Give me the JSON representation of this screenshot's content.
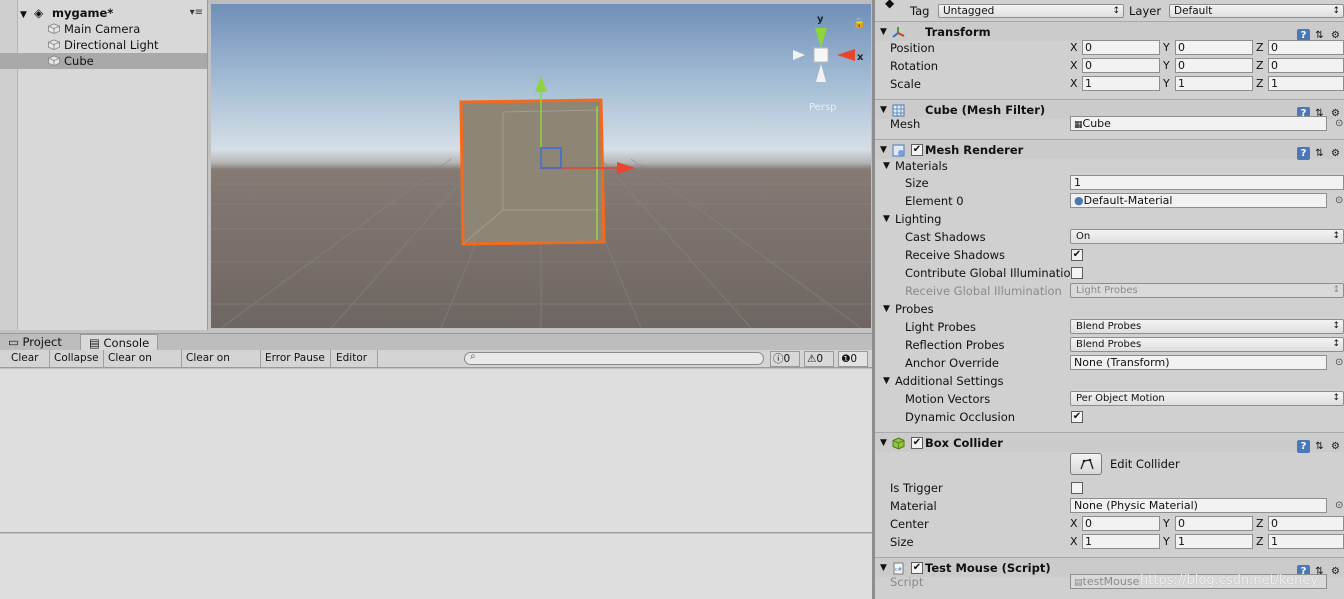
{
  "hierarchy": {
    "root": "mygame*",
    "items": [
      "Main Camera",
      "Directional Light",
      "Cube"
    ],
    "selected": "Cube"
  },
  "scene": {
    "gizmo": {
      "x_label": "x",
      "y_label": "y",
      "persp_label": "Persp"
    }
  },
  "console": {
    "tabs": [
      "Project",
      "Console"
    ],
    "active_tab": "Console",
    "toolbar": [
      "Clear",
      "Collapse",
      "Clear on Play",
      "Clear on Build",
      "Error Pause",
      "Editor"
    ],
    "counts": {
      "info": "0",
      "warning": "0",
      "error": "0"
    }
  },
  "inspector": {
    "tag_label": "Tag",
    "tag_value": "Untagged",
    "layer_label": "Layer",
    "layer_value": "Default",
    "transform": {
      "title": "Transform",
      "rows": [
        {
          "label": "Position",
          "x": "0",
          "y": "0",
          "z": "0"
        },
        {
          "label": "Rotation",
          "x": "0",
          "y": "0",
          "z": "0"
        },
        {
          "label": "Scale",
          "x": "1",
          "y": "1",
          "z": "1"
        }
      ]
    },
    "mesh_filter": {
      "title": "Cube (Mesh Filter)",
      "mesh_label": "Mesh",
      "mesh_value": "Cube"
    },
    "mesh_renderer": {
      "title": "Mesh Renderer",
      "materials_label": "Materials",
      "size_label": "Size",
      "size_value": "1",
      "element0_label": "Element 0",
      "element0_value": "Default-Material",
      "lighting_label": "Lighting",
      "cast_shadows_label": "Cast Shadows",
      "cast_shadows_value": "On",
      "receive_shadows_label": "Receive Shadows",
      "contribute_gi_label": "Contribute Global Illumination",
      "receive_gi_label": "Receive Global Illumination",
      "receive_gi_value": "Light Probes",
      "probes_label": "Probes",
      "light_probes_label": "Light Probes",
      "light_probes_value": "Blend Probes",
      "reflection_probes_label": "Reflection Probes",
      "reflection_probes_value": "Blend Probes",
      "anchor_override_label": "Anchor Override",
      "anchor_override_value": "None (Transform)",
      "additional_label": "Additional Settings",
      "motion_vectors_label": "Motion Vectors",
      "motion_vectors_value": "Per Object Motion",
      "dynamic_occlusion_label": "Dynamic Occlusion"
    },
    "box_collider": {
      "title": "Box Collider",
      "edit_collider_label": "Edit Collider",
      "is_trigger_label": "Is Trigger",
      "material_label": "Material",
      "material_value": "None (Physic Material)",
      "center_label": "Center",
      "center": {
        "x": "0",
        "y": "0",
        "z": "0"
      },
      "size_label": "Size",
      "size": {
        "x": "1",
        "y": "1",
        "z": "1"
      }
    },
    "test_mouse": {
      "title": "Test Mouse (Script)",
      "script_label": "Script",
      "script_value": "testMouse"
    }
  },
  "watermark": "https://blog.csdn.net/keney",
  "colors": {
    "selection_orange": "#f26b1d",
    "axis_green": "#8fd43a",
    "axis_red": "#e8452c",
    "axis_blue": "#3a6ad8",
    "help_blue": "#4a78b8"
  }
}
